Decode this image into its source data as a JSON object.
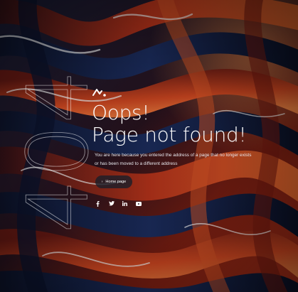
{
  "error": {
    "ghost_code": "404",
    "title_line1": "Oops!",
    "title_line2": "Page not found!",
    "description_line1": "You are here because you entered the address of a page that no longer exists",
    "description_line2": "or has been moved to a different address"
  },
  "actions": {
    "home_label": "Home page",
    "home_arrow": "›"
  },
  "social": [
    {
      "icon": "facebook-icon"
    },
    {
      "icon": "twitter-icon"
    },
    {
      "icon": "linkedin-icon"
    },
    {
      "icon": "youtube-icon"
    }
  ],
  "colors": {
    "background": "#0b0d16",
    "accent_red": "#d23a1e",
    "accent_orange": "#f0722e",
    "accent_blue": "#1a2b5a",
    "text": "#ffffff"
  }
}
